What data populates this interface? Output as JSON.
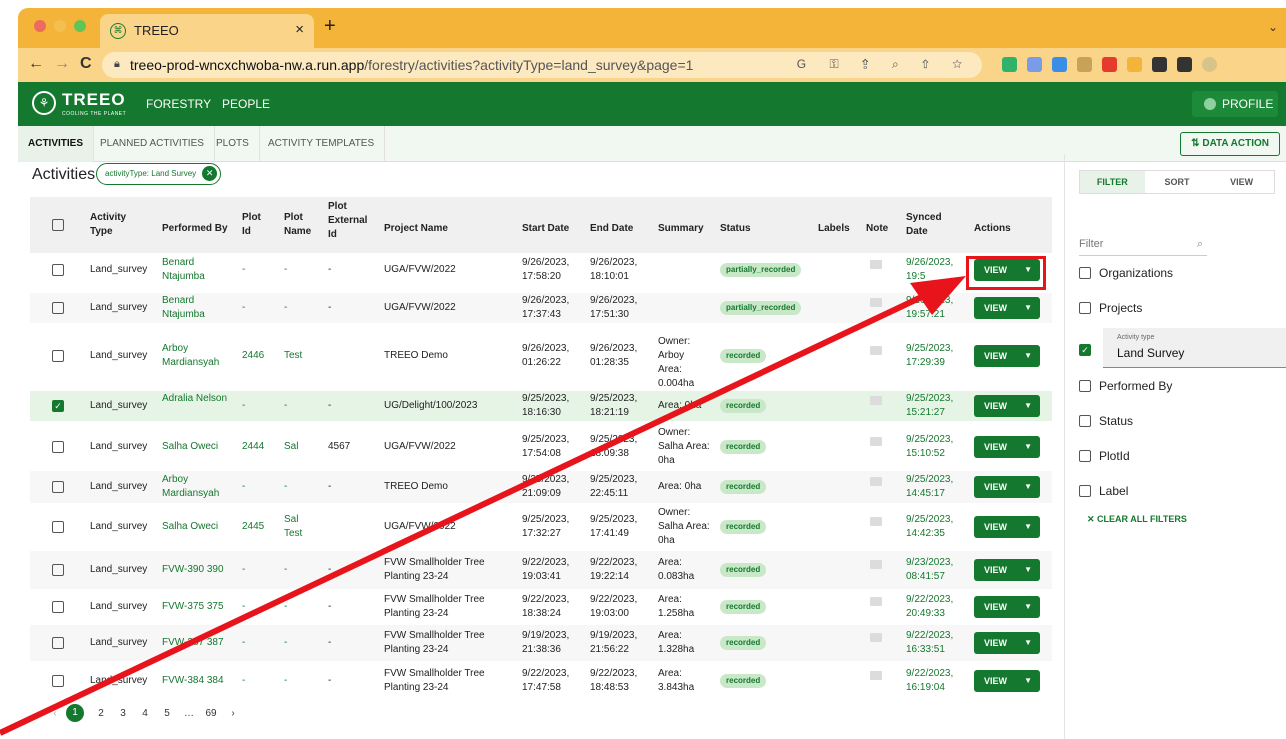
{
  "browser": {
    "tab_title": "TREEO",
    "tab_close": "×",
    "new_tab": "+",
    "url_host": "treeo-prod-wncxchwoba-nw.a.run.app",
    "url_path": "/forestry/activities?activityType=land_survey&page=1",
    "back_icon": "←",
    "forward_icon": "→",
    "reload_icon": "C"
  },
  "app": {
    "logo": "TREEO",
    "tagline": "COOLING THE PLANET",
    "nav": [
      "FORESTRY",
      "PEOPLE"
    ],
    "profile_label": "PROFILE",
    "subtabs": [
      "ACTIVITIES",
      "PLANNED ACTIVITIES",
      "PLOTS",
      "ACTIVITY TEMPLATES"
    ],
    "data_action_label": "DATA ACTION",
    "page_title": "Activities",
    "filter_chip": "activityType: Land Survey"
  },
  "table": {
    "headers": {
      "activity_type": "Activity Type",
      "performed_by": "Performed By",
      "plot_id": "Plot Id",
      "plot_name": "Plot Name",
      "plot_external_id": "Plot External Id",
      "project_name": "Project Name",
      "start_date": "Start Date",
      "end_date": "End Date",
      "summary": "Summary",
      "status": "Status",
      "labels": "Labels",
      "note": "Note",
      "synced_date": "Synced Date",
      "actions": "Actions"
    },
    "view_label": "VIEW",
    "rows": [
      {
        "type": "Land_survey",
        "by": "Benard Ntajumba",
        "plot_id": "-",
        "plot_name": "-",
        "ext": "-",
        "project": "UGA/FVW/2022",
        "start": "9/26/2023, 17:58:20",
        "end": "9/26/2023, 18:10:01",
        "summary": "",
        "status": "partially_recorded",
        "synced": "9/26/2023, 19:5",
        "checked": false
      },
      {
        "type": "Land_survey",
        "by": "Benard Ntajumba",
        "plot_id": "-",
        "plot_name": "-",
        "ext": "-",
        "project": "UGA/FVW/2022",
        "start": "9/26/2023, 17:37:43",
        "end": "9/26/2023, 17:51:30",
        "summary": "",
        "status": "partially_recorded",
        "synced": "9/26/2023, 19:57:21",
        "checked": false
      },
      {
        "type": "Land_survey",
        "by": "Arboy Mardiansyah",
        "plot_id": "2446",
        "plot_name": "Test",
        "ext": "",
        "project": "TREEO Demo",
        "start": "9/26/2023, 01:26:22",
        "end": "9/26/2023, 01:28:35",
        "summary": "Owner: Arboy Area: 0.004ha",
        "status": "recorded",
        "synced": "9/25/2023, 17:29:39",
        "checked": false
      },
      {
        "type": "Land_survey",
        "by": "Adralia Nelson",
        "plot_id": "-",
        "plot_name": "-",
        "ext": "-",
        "project": "UG/Delight/100/2023",
        "start": "9/25/2023, 18:16:30",
        "end": "9/25/2023, 18:21:19",
        "summary": "Area: 0ha",
        "status": "recorded",
        "synced": "9/25/2023, 15:21:27",
        "checked": true
      },
      {
        "type": "Land_survey",
        "by": "Salha Oweci",
        "plot_id": "2444",
        "plot_name": "Sal",
        "ext": "4567",
        "project": "UGA/FVW/2022",
        "start": "9/25/2023, 17:54:08",
        "end": "9/25/2023, 18:09:38",
        "summary": "Owner: Salha Area: 0ha",
        "status": "recorded",
        "synced": "9/25/2023, 15:10:52",
        "checked": false
      },
      {
        "type": "Land_survey",
        "by": "Arboy Mardiansyah",
        "plot_id": "-",
        "plot_name": "-",
        "ext": "-",
        "project": "TREEO Demo",
        "start": "9/25/2023, 21:09:09",
        "end": "9/25/2023, 22:45:11",
        "summary": "Area: 0ha",
        "status": "recorded",
        "synced": "9/25/2023, 14:45:17",
        "checked": false
      },
      {
        "type": "Land_survey",
        "by": "Salha Oweci",
        "plot_id": "2445",
        "plot_name": "Sal Test",
        "ext": "",
        "project": "UGA/FVW/2022",
        "start": "9/25/2023, 17:32:27",
        "end": "9/25/2023, 17:41:49",
        "summary": "Owner: Salha Area: 0ha",
        "status": "recorded",
        "synced": "9/25/2023, 14:42:35",
        "checked": false
      },
      {
        "type": "Land_survey",
        "by": "FVW-390 390",
        "plot_id": "-",
        "plot_name": "-",
        "ext": "-",
        "project": "FVW Smallholder Tree Planting 23-24",
        "start": "9/22/2023, 19:03:41",
        "end": "9/22/2023, 19:22:14",
        "summary": "Area: 0.083ha",
        "status": "recorded",
        "synced": "9/23/2023, 08:41:57",
        "checked": false
      },
      {
        "type": "Land_survey",
        "by": "FVW-375 375",
        "plot_id": "-",
        "plot_name": "-",
        "ext": "-",
        "project": "FVW Smallholder Tree Planting 23-24",
        "start": "9/22/2023, 18:38:24",
        "end": "9/22/2023, 19:03:00",
        "summary": "Area: 1.258ha",
        "status": "recorded",
        "synced": "9/22/2023, 20:49:33",
        "checked": false
      },
      {
        "type": "Land_survey",
        "by": "FVW-387 387",
        "plot_id": "-",
        "plot_name": "-",
        "ext": "-",
        "project": "FVW Smallholder Tree Planting 23-24",
        "start": "9/19/2023, 21:38:36",
        "end": "9/19/2023, 21:56:22",
        "summary": "Area: 1.328ha",
        "status": "recorded",
        "synced": "9/22/2023, 16:33:51",
        "checked": false
      },
      {
        "type": "Land_survey",
        "by": "FVW-384 384",
        "plot_id": "-",
        "plot_name": "-",
        "ext": "-",
        "project": "FVW Smallholder Tree Planting 23-24",
        "start": "9/22/2023, 17:47:58",
        "end": "9/22/2023, 18:48:53",
        "summary": "Area: 3.843ha",
        "status": "recorded",
        "synced": "9/22/2023, 16:19:04",
        "checked": false
      }
    ]
  },
  "pagination": {
    "prev": "‹",
    "pages": [
      "1",
      "2",
      "3",
      "4",
      "5",
      "…",
      "69"
    ],
    "next": "›",
    "current": "1"
  },
  "filter_panel": {
    "tabs": [
      "FILTER",
      "SORT",
      "VIEW"
    ],
    "search_placeholder": "Filter",
    "items": [
      "Organizations",
      "Projects",
      "Performed By",
      "Status",
      "PlotId",
      "Label"
    ],
    "activity_type_label": "Activity type",
    "activity_type_value": "Land Survey",
    "clear_label": "CLEAR ALL FILTERS"
  },
  "colors": {
    "brand_green": "#14782e",
    "tab_strip": "#f4b43a",
    "annotation_red": "#e8141b"
  }
}
